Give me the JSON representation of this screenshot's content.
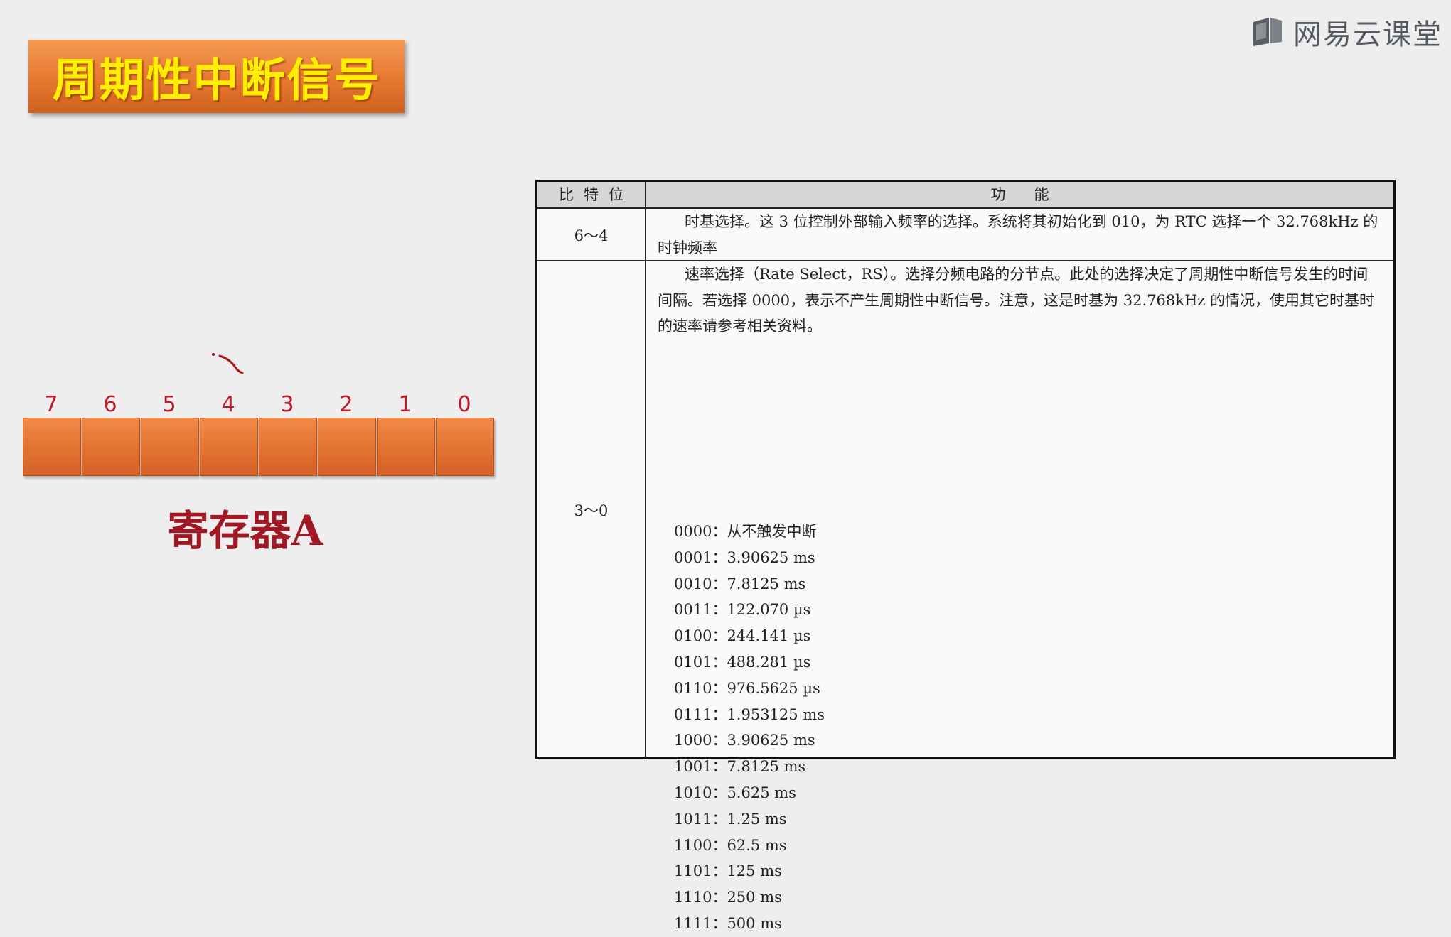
{
  "slide": {
    "title": "周期性中断信号",
    "logo_text": "网易云课堂",
    "logo_icon": "book-icon",
    "register_label": "寄存器A",
    "bit_numbers": [
      "7",
      "6",
      "5",
      "4",
      "3",
      "2",
      "1",
      "0"
    ]
  },
  "table": {
    "headers": [
      "比特位",
      "功能"
    ],
    "rows": [
      {
        "bits": "6～4",
        "text": "时基选择。这 3 位控制外部输入频率的选择。系统将其初始化到 010，为 RTC 选择一个 32.768kHz 的时钟频率"
      },
      {
        "bits": "3～0",
        "text": "速率选择（Rate Select，RS）。选择分频电路的分节点。此处的选择决定了周期性中断信号发生的时间间隔。若选择 0000，表示不产生周期性中断信号。注意，这是时基为 32.768kHz 的情况，使用其它时基时的速率请参考相关资料。",
        "options": [
          "0000：从不触发中断",
          "0001：3.90625 ms",
          "0010：7.8125 ms",
          "0011：122.070 µs",
          "0100：244.141 µs",
          "0101：488.281 µs",
          "0110：976.5625 µs",
          "0111：1.953125 ms",
          "1000：3.90625 ms",
          "1001：7.8125 ms",
          "1010：5.625 ms",
          "1011：1.25 ms",
          "1100：62.5 ms",
          "1101：125 ms",
          "1110：250 ms",
          "1111：500 ms"
        ]
      }
    ]
  },
  "colors": {
    "title_text": "#ffee00",
    "title_bg": "#e7782f",
    "bit_number": "#c0192c",
    "register_label": "#a11724",
    "cell": "#e2702e"
  }
}
